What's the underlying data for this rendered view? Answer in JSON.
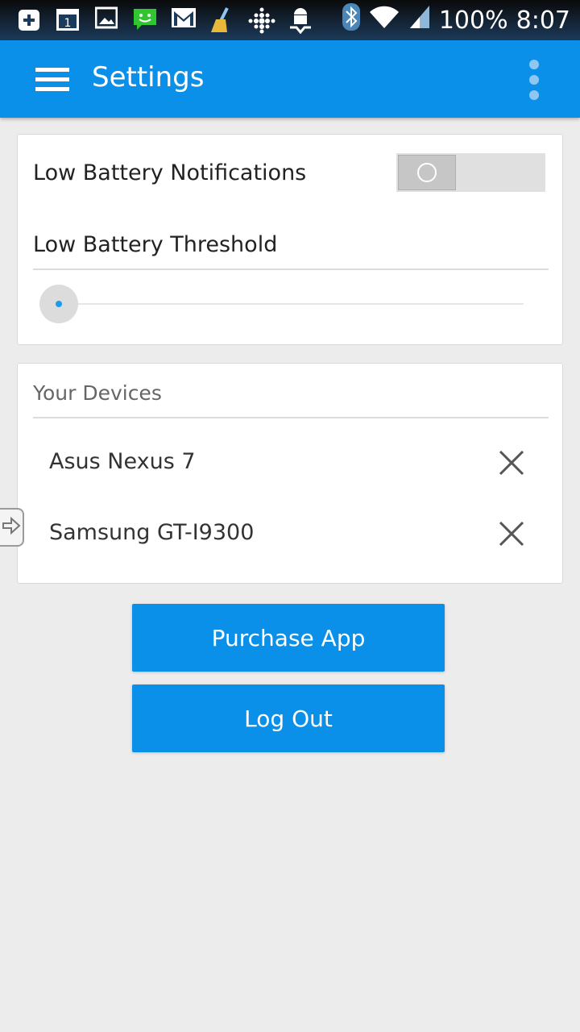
{
  "status_bar": {
    "battery": "100%",
    "time": "8:07",
    "icons": [
      "add-icon",
      "calendar-icon",
      "image-icon",
      "message-icon",
      "gmail-icon",
      "broom-icon",
      "fitbit-icon",
      "android-download-icon",
      "bluetooth-icon",
      "wifi-icon",
      "signal-icon"
    ]
  },
  "app_bar": {
    "title": "Settings"
  },
  "notifications": {
    "label": "Low Battery Notifications",
    "enabled": false,
    "threshold_label": "Low Battery Threshold",
    "threshold_value": 0
  },
  "devices": {
    "header": "Your Devices",
    "items": [
      {
        "name": "Asus Nexus 7"
      },
      {
        "name": "Samsung GT-I9300"
      }
    ]
  },
  "buttons": {
    "purchase": "Purchase App",
    "logout": "Log Out"
  },
  "colors": {
    "primary": "#0a90e8",
    "background": "#ececec",
    "accent_dot": "#1c9be8"
  }
}
